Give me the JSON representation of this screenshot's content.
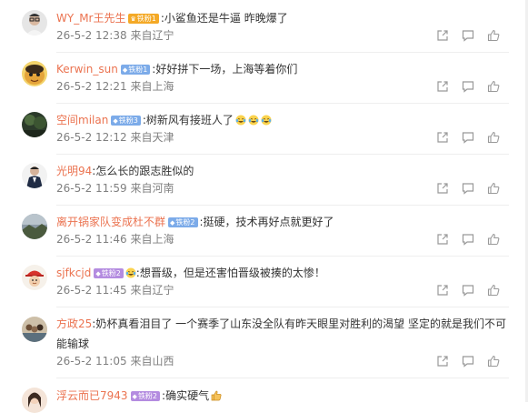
{
  "colors": {
    "username": "#eb7350",
    "text": "#333333",
    "meta": "#808080",
    "badge_gold": "#f4a926",
    "badge_blue": "#7cabe9",
    "badge_purple": "#b48ce0"
  },
  "action_icons": [
    "share-icon",
    "reply-icon",
    "like-icon"
  ],
  "comments": [
    {
      "username": "WY_Mr王先生",
      "badge": {
        "label": "铁粉1",
        "icon": "crown-icon",
        "color": "#f4a926"
      },
      "text": ":小鲨鱼还是牛逼  昨晚爆了",
      "time": "26-5-2 12:38",
      "location": "来自辽宁",
      "avatar": "avatar-man-glasses"
    },
    {
      "username": "Kerwin_sun",
      "badge": {
        "label": "铁粉1",
        "icon": "diamond-icon",
        "color": "#7cabe9"
      },
      "text": ":好好拼下一场，上海等着你们",
      "time": "26-5-2 12:21",
      "location": "来自上海",
      "avatar": "avatar-cartoon-face"
    },
    {
      "username": "空间milan",
      "badge": {
        "label": "铁粉3",
        "icon": "diamond-icon",
        "color": "#7cabe9"
      },
      "text": ":树新风有接班人了",
      "emoji_count": 3,
      "time": "26-5-2 12:12",
      "location": "来自天津",
      "avatar": "avatar-dark-photo"
    },
    {
      "username": "光明94",
      "text": ":怎么长的跟志胜似的",
      "time": "26-5-2 11:59",
      "location": "来自河南",
      "avatar": "avatar-man-suit"
    },
    {
      "username": "离开锅家队变成杜不群",
      "badge": {
        "label": "铁粉2",
        "icon": "diamond-icon",
        "color": "#7cabe9"
      },
      "text": ":挺硬，技术再好点就更好了",
      "time": "26-5-2 11:46",
      "location": "来自上海",
      "avatar": "avatar-landscape"
    },
    {
      "username": "sjfkcjd",
      "badge": {
        "label": "铁粉2",
        "icon": "diamond-icon",
        "color": "#b48ce0"
      },
      "text": ":想晋级，但是还害怕晋级被揍的太惨！",
      "emoji_prefix": true,
      "time": "26-5-2 11:45",
      "location": "来自辽宁",
      "avatar": "avatar-red-cap"
    },
    {
      "username": "方政25",
      "text": ":奶杯真看泪目了 一个赛季了山东没全队有昨天眼里对胜利的渴望 坚定的就是我们不可能输球",
      "time": "26-5-2 11:05",
      "location": "来自山西",
      "avatar": "avatar-group-photo"
    },
    {
      "username": "浮云而已7943",
      "badge": {
        "label": "铁粉2",
        "icon": "diamond-icon",
        "color": "#b48ce0"
      },
      "text": ":确实硬气",
      "emoji_suffix": "thumbs-up",
      "avatar": "avatar-girl"
    }
  ]
}
